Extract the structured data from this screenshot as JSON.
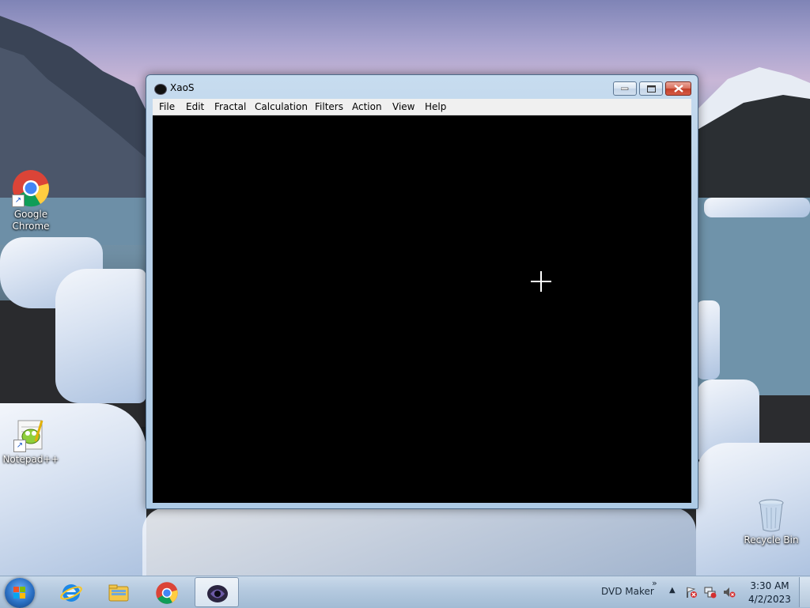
{
  "desktop": {
    "icons": [
      {
        "label": "Google\nChrome",
        "icon": "chrome-icon"
      },
      {
        "label": "Notepad++",
        "icon": "notepadpp-icon"
      },
      {
        "label": "Recycle Bin",
        "icon": "recycle-bin-icon"
      }
    ]
  },
  "window": {
    "title": "XaoS",
    "icon": "xaos-icon",
    "menu": [
      "File",
      "Edit",
      "Fractal",
      "Calculation",
      "Filters",
      "Action",
      "View",
      "Help"
    ],
    "canvas_color": "#000000",
    "cursor": "crosshair-cursor"
  },
  "taskbar": {
    "pinned": [
      "internet-explorer-icon",
      "file-explorer-icon",
      "chrome-icon",
      "xaos-icon"
    ],
    "active": "xaos-icon",
    "tray_label": "DVD Maker",
    "tray_chevron": "»",
    "tray_up": "▲",
    "tray_icons": [
      "action-center-flag-icon",
      "network-icon",
      "volume-muted-icon"
    ],
    "clock": {
      "time": "3:30 AM",
      "date": "4/2/2023"
    }
  }
}
